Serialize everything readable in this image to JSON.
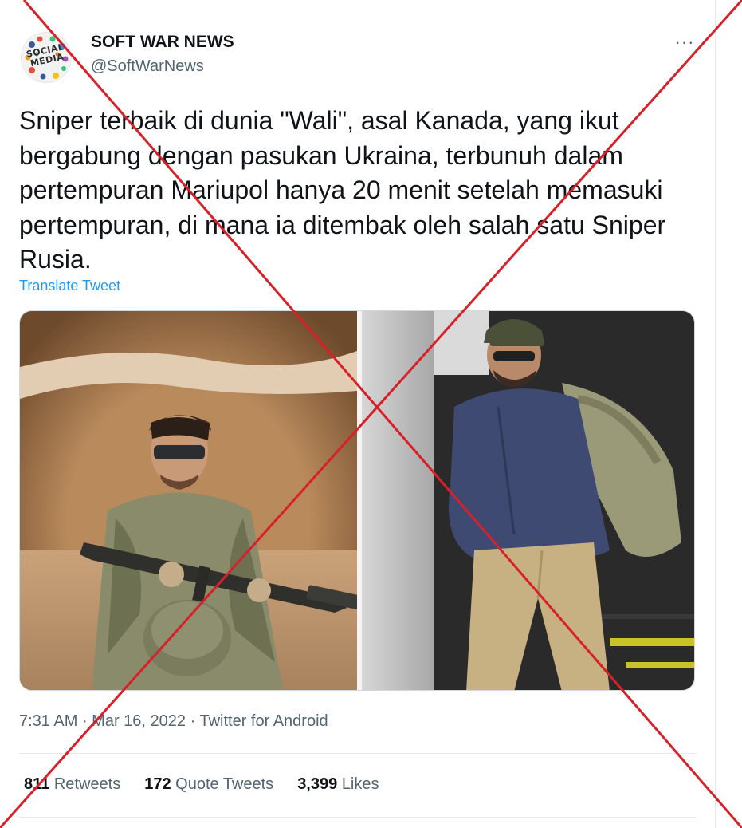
{
  "account": {
    "display_name": "SOFT WAR NEWS",
    "handle": "@SoftWarNews",
    "avatar_text": "SOCIAL MEDIA"
  },
  "more_label": "···",
  "tweet": {
    "text": "Sniper terbaik di dunia \"Wali\", asal Kanada, yang ikut bergabung dengan  pasukan Ukraina, terbunuh dalam pertempuran Mariupol hanya 20 menit setelah memasuki pertempuran, di mana ia ditembak oleh salah satu Sniper Rusia.",
    "translate_label": "Translate Tweet",
    "time": "7:31 AM",
    "date": "Mar 16, 2022",
    "source": "Twitter for Android",
    "separator": " · "
  },
  "stats": {
    "retweets_count": "811",
    "retweets_label": "Retweets",
    "quotes_count": "172",
    "quotes_label": "Quote Tweets",
    "likes_count": "3,399",
    "likes_label": "Likes"
  },
  "colors": {
    "link": "#1d9bf0",
    "secondary_text": "#536471",
    "cross": "#d8202a"
  }
}
